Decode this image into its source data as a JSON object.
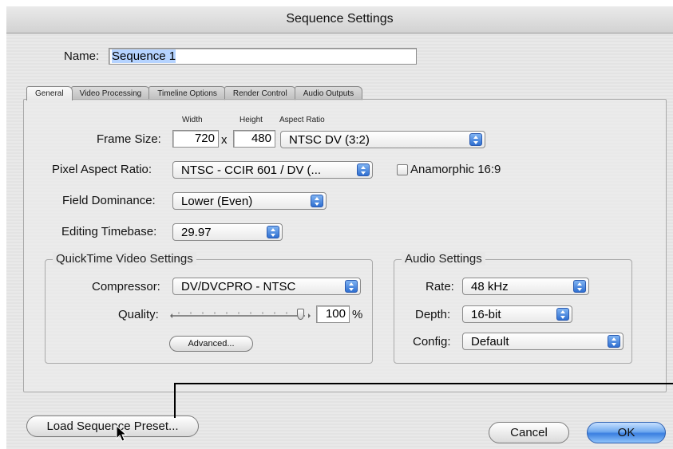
{
  "window": {
    "title": "Sequence Settings"
  },
  "name_field": {
    "label": "Name:",
    "value": "Sequence 1"
  },
  "tabs": [
    {
      "label": "General",
      "selected": true
    },
    {
      "label": "Video Processing",
      "selected": false
    },
    {
      "label": "Timeline Options",
      "selected": false
    },
    {
      "label": "Render Control",
      "selected": false
    },
    {
      "label": "Audio Outputs",
      "selected": false
    }
  ],
  "frame_size": {
    "label": "Frame Size:",
    "width_header": "Width",
    "height_header": "Height",
    "aspect_header": "Aspect Ratio",
    "width": "720",
    "x_sep": "x",
    "height": "480",
    "aspect_ratio": "NTSC DV (3:2)"
  },
  "pixel_aspect": {
    "label": "Pixel Aspect Ratio:",
    "value": "NTSC - CCIR 601 / DV (..."
  },
  "anamorphic": {
    "label": "Anamorphic 16:9",
    "checked": false
  },
  "field_dominance": {
    "label": "Field Dominance:",
    "value": "Lower (Even)"
  },
  "editing_timebase": {
    "label": "Editing Timebase:",
    "value": "29.97"
  },
  "quicktime": {
    "title": "QuickTime Video Settings",
    "compressor_label": "Compressor:",
    "compressor_value": "DV/DVCPRO - NTSC",
    "quality_label": "Quality:",
    "quality_value": "100",
    "quality_unit": "%",
    "quality_level": 1.0,
    "advanced_button": "Advanced..."
  },
  "audio": {
    "title": "Audio Settings",
    "rate_label": "Rate:",
    "rate_value": "48 kHz",
    "depth_label": "Depth:",
    "depth_value": "16-bit",
    "config_label": "Config:",
    "config_value": "Default"
  },
  "buttons": {
    "load_preset": "Load Sequence Preset...",
    "cancel": "Cancel",
    "ok": "OK"
  },
  "colors": {
    "accent": "#3b7fe0",
    "name_highlight": "#b5d3ff"
  }
}
